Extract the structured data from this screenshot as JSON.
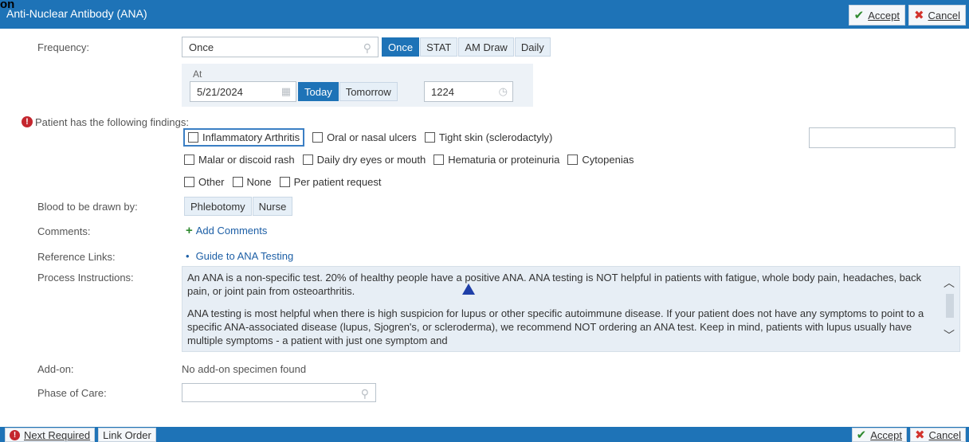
{
  "window": {
    "title": "Anti-Nuclear Antibody (ANA)",
    "overlay_text": "on",
    "accept_label": "Accept",
    "cancel_label": "Cancel"
  },
  "frequency": {
    "label": "Frequency:",
    "value": "Once",
    "options": [
      "Once",
      "STAT",
      "AM Draw",
      "Daily"
    ],
    "selected": "Once"
  },
  "at": {
    "label": "At",
    "date": "5/21/2024",
    "today_label": "Today",
    "tomorrow_label": "Tomorrow",
    "time": "1224"
  },
  "findings": {
    "label": "Patient has the following findings:",
    "rows": [
      [
        "Inflammatory Arthritis",
        "Oral or nasal ulcers",
        "Tight skin (sclerodactyly)"
      ],
      [
        "Malar or discoid rash",
        "Daily dry eyes or mouth",
        "Hematuria or proteinuria",
        "Cytopenias"
      ],
      [
        "Other",
        "None",
        "Per patient request"
      ]
    ]
  },
  "blood": {
    "label": "Blood to be drawn by:",
    "options": [
      "Phlebotomy",
      "Nurse"
    ]
  },
  "comments": {
    "label": "Comments:",
    "add_label": "Add Comments"
  },
  "reference": {
    "label": "Reference Links:",
    "link": "Guide to ANA Testing"
  },
  "instructions": {
    "label": "Process Instructions:",
    "paragraphs": [
      "An ANA is a non-specific test. 20% of healthy people have a positive ANA. ANA testing is NOT helpful in patients with fatigue, whole body pain, headaches, back pain, or joint pain from osteoarthritis.",
      "ANA testing is most helpful when there is high suspicion for lupus or other specific autoimmune disease. If your patient does not have any symptoms to point to a specific ANA-associated disease (lupus, Sjogren's, or scleroderma), we recommend NOT ordering an ANA test.  Keep in mind, patients with lupus usually have multiple symptoms - a patient with just one symptom and"
    ]
  },
  "addon": {
    "label": "Add-on:",
    "value": "No add-on specimen found"
  },
  "phase": {
    "label": "Phase of Care:",
    "value": ""
  },
  "footer": {
    "next_required": "Next Required",
    "link_order": "Link Order",
    "accept_label": "Accept",
    "cancel_label": "Cancel"
  }
}
